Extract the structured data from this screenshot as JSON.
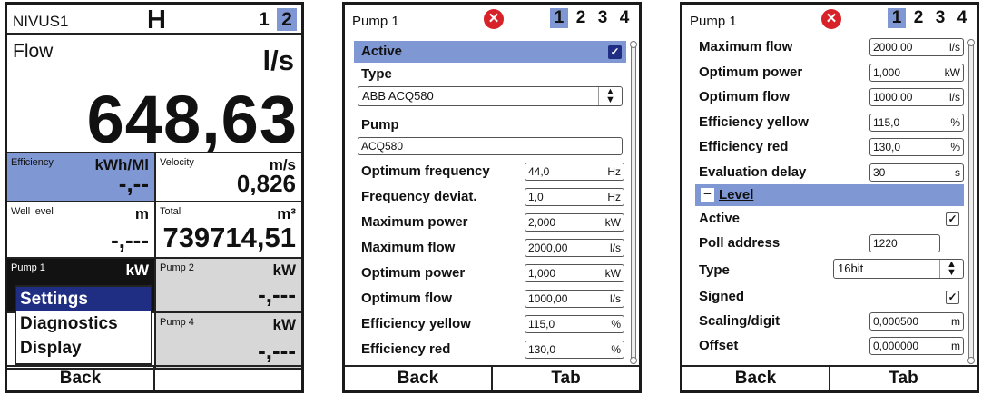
{
  "screen1": {
    "title": "NIVUS1",
    "mode": "H",
    "tabs": [
      "1",
      "2"
    ],
    "active_tab": "2",
    "flow": {
      "label": "Flow",
      "unit": "l/s",
      "value": "648,63"
    },
    "cells": {
      "efficiency": {
        "label": "Efficiency",
        "unit": "kWh/Ml",
        "value": "-,--"
      },
      "velocity": {
        "label": "Velocity",
        "unit": "m/s",
        "value": "0,826"
      },
      "well_level": {
        "label": "Well level",
        "unit": "m",
        "value": "-,---"
      },
      "total": {
        "label": "Total",
        "unit": "m³",
        "value": "739714,51"
      },
      "pump1": {
        "label": "Pump 1",
        "unit": "kW"
      },
      "pump2": {
        "label": "Pump 2",
        "unit": "kW",
        "value": "-,---"
      },
      "pump4": {
        "label": "Pump 4",
        "unit": "kW",
        "value": "-,---"
      }
    },
    "menu": [
      "Settings",
      "Diagnostics",
      "Display"
    ],
    "footer": [
      "Back",
      ""
    ]
  },
  "screen2": {
    "title": "Pump 1",
    "tabs": [
      "1",
      "2",
      "3",
      "4"
    ],
    "active_tab": "1",
    "active_label": "Active",
    "type_label": "Type",
    "type_value": "ABB ACQ580",
    "pump_label": "Pump",
    "pump_value": "ACQ580",
    "rows": [
      {
        "label": "Optimum frequency",
        "value": "44,0",
        "unit": "Hz"
      },
      {
        "label": "Frequency deviat.",
        "value": "1,0",
        "unit": "Hz"
      },
      {
        "label": "Maximum power",
        "value": "2,000",
        "unit": "kW"
      },
      {
        "label": "Maximum flow",
        "value": "2000,00",
        "unit": "l/s"
      },
      {
        "label": "Optimum power",
        "value": "1,000",
        "unit": "kW"
      },
      {
        "label": "Optimum flow",
        "value": "1000,00",
        "unit": "l/s"
      },
      {
        "label": "Efficiency yellow",
        "value": "115,0",
        "unit": "%"
      },
      {
        "label": "Efficiency red",
        "value": "130,0",
        "unit": "%"
      }
    ],
    "footer": [
      "Back",
      "Tab"
    ]
  },
  "screen3": {
    "title": "Pump 1",
    "tabs": [
      "1",
      "2",
      "3",
      "4"
    ],
    "active_tab": "1",
    "rows": [
      {
        "label": "Maximum flow",
        "value": "2000,00",
        "unit": "l/s"
      },
      {
        "label": "Optimum power",
        "value": "1,000",
        "unit": "kW"
      },
      {
        "label": "Optimum flow",
        "value": "1000,00",
        "unit": "l/s"
      },
      {
        "label": "Efficiency yellow",
        "value": "115,0",
        "unit": "%"
      },
      {
        "label": "Efficiency red",
        "value": "130,0",
        "unit": "%"
      },
      {
        "label": "Evaluation delay",
        "value": "30",
        "unit": "s"
      }
    ],
    "level_section": "Level",
    "level_rows": {
      "active": "Active",
      "poll_address_label": "Poll address",
      "poll_address_value": "1220",
      "type_label": "Type",
      "type_value": "16bit",
      "signed": "Signed",
      "scaling_label": "Scaling/digit",
      "scaling_value": "0,000500",
      "scaling_unit": "m",
      "offset_label": "Offset",
      "offset_value": "0,000000",
      "offset_unit": "m"
    },
    "footer": [
      "Back",
      "Tab"
    ]
  },
  "colors": {
    "highlight": "#7f97d2",
    "menu_selected": "#1f2d82",
    "close": "#d8222a",
    "cell_gray": "#d7d7d7"
  },
  "icons": {
    "close": "close-icon",
    "checkbox": "checkmark-icon",
    "select": "updown-arrows-icon",
    "collapse": "minus-icon"
  }
}
